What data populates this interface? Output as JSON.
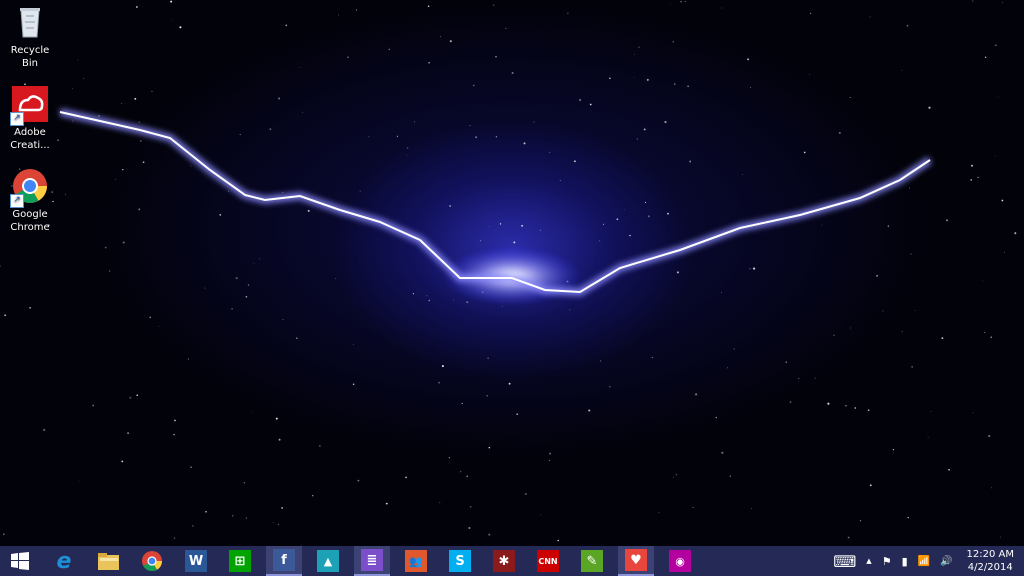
{
  "desktop": {
    "icons": [
      {
        "label": "Recycle Bin"
      },
      {
        "label": "Adobe Creati..."
      },
      {
        "label": "Google Chrome"
      }
    ]
  },
  "taskbar": {
    "apps": [
      {
        "name": "start-button",
        "icon": "windows-logo-icon",
        "glyph": "",
        "color": "#242a55"
      },
      {
        "name": "internet-explorer",
        "icon": "internet-explorer-icon",
        "glyph": "e",
        "color": "#1e90d8"
      },
      {
        "name": "file-explorer",
        "icon": "folder-icon",
        "glyph": "",
        "color": "#e8c45a"
      },
      {
        "name": "chrome",
        "icon": "chrome-icon",
        "glyph": "",
        "color": "#e8453c"
      },
      {
        "name": "word",
        "icon": "word-icon",
        "glyph": "W",
        "color": "#2b5797"
      },
      {
        "name": "store",
        "icon": "store-icon",
        "glyph": "⊞",
        "color": "#00a300"
      },
      {
        "name": "facebook",
        "icon": "facebook-icon",
        "glyph": "f",
        "color": "#3b5998"
      },
      {
        "name": "photos",
        "icon": "photos-icon",
        "glyph": "▲",
        "color": "#1da1b6"
      },
      {
        "name": "reader",
        "icon": "reader-icon",
        "glyph": "≣",
        "color": "#7a4fc9"
      },
      {
        "name": "people",
        "icon": "people-icon",
        "glyph": "👥",
        "color": "#e0582b"
      },
      {
        "name": "skype",
        "icon": "skype-icon",
        "glyph": "S",
        "color": "#00aff0"
      },
      {
        "name": "yelp",
        "icon": "asterisk-icon",
        "glyph": "✱",
        "color": "#8b1a1a"
      },
      {
        "name": "cnn",
        "icon": "cnn-icon",
        "glyph": "CNN",
        "color": "#cc0000"
      },
      {
        "name": "evernote",
        "icon": "evernote-icon",
        "glyph": "✎",
        "color": "#5ba525"
      },
      {
        "name": "health",
        "icon": "heart-icon",
        "glyph": "♥",
        "color": "#e8453c"
      },
      {
        "name": "camera",
        "icon": "camera-icon",
        "glyph": "◉",
        "color": "#b4009e"
      }
    ]
  },
  "tray": {
    "keyboard": "⌨",
    "chevron": "▲",
    "flag": "⚑",
    "battery": "▮",
    "signal": "📶",
    "volume": "🔊"
  },
  "clock": {
    "time": "12:20 AM",
    "date": "4/2/2014"
  },
  "colors": {
    "taskbar": "#242a55",
    "accent": "#8c93d8"
  }
}
